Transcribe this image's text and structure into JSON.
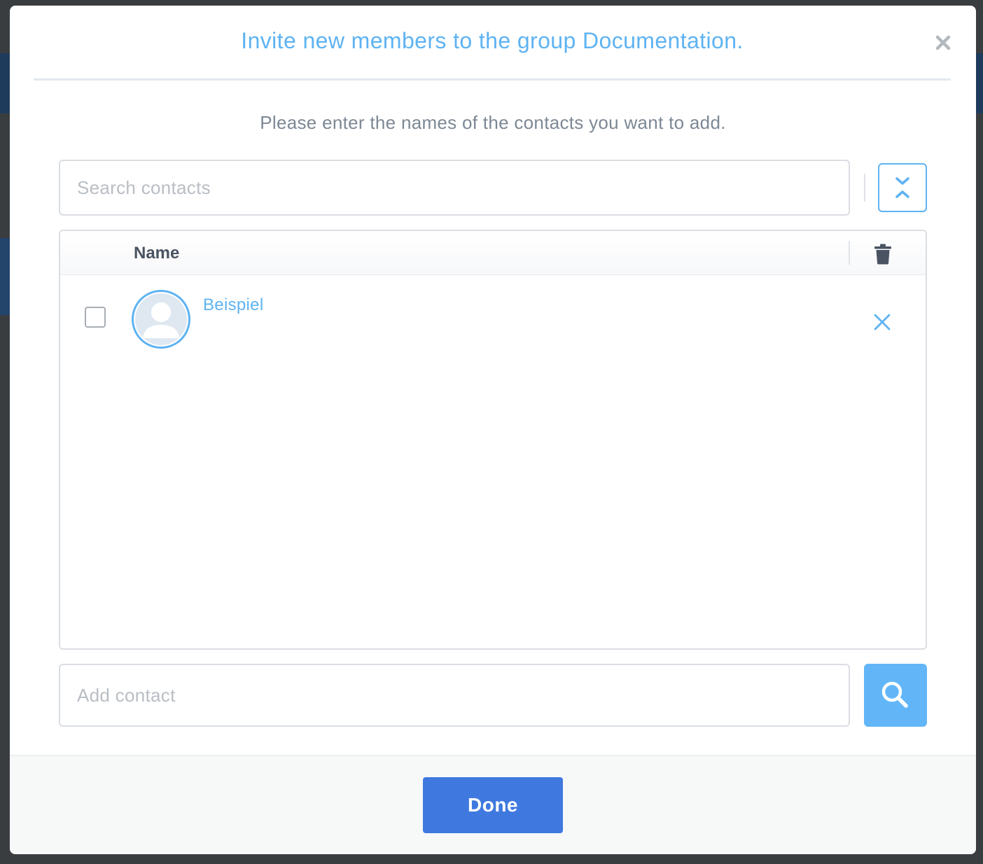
{
  "modal": {
    "title": "Invite new members to the group Documentation.",
    "instruction": "Please enter the names of the contacts you want to add."
  },
  "search": {
    "placeholder": "Search contacts"
  },
  "table": {
    "columns": [
      "Name"
    ],
    "rows": [
      {
        "name": "Beispiel",
        "checked": false
      }
    ]
  },
  "add_contact": {
    "placeholder": "Add contact"
  },
  "footer": {
    "done_label": "Done"
  },
  "icons": {
    "close": "close-icon",
    "toggle": "expand-collapse-icon",
    "trash": "trash-icon",
    "remove": "remove-icon",
    "search": "search-icon",
    "avatar": "user-placeholder-icon"
  },
  "colors": {
    "accent": "#5eb3f2",
    "primary_button": "#3f79e0",
    "search_button": "#62b6f7",
    "text_muted": "#7d8894",
    "header_text": "#4a5361"
  }
}
